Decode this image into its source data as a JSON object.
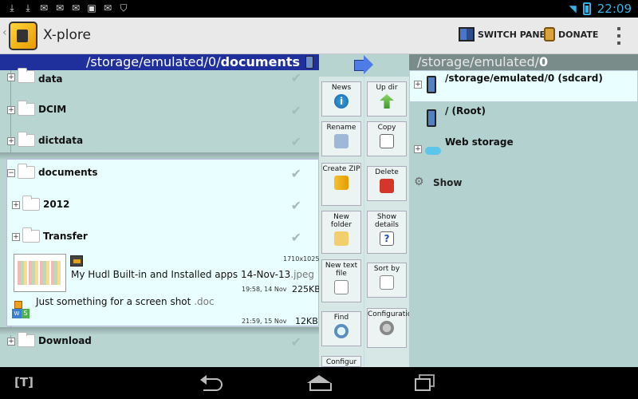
{
  "status": {
    "time": "22:09"
  },
  "actionbar": {
    "app_title": "X-plore",
    "switch_pane": "SWITCH PANE",
    "donate": "DONATE"
  },
  "left": {
    "path_prefix": "/storage/emulated/0/",
    "path_bold": "documents",
    "rows": [
      {
        "label": "data"
      },
      {
        "label": "DCIM"
      },
      {
        "label": "dictdata"
      },
      {
        "label": "documents"
      },
      {
        "label": "2012"
      },
      {
        "label": "Transfer"
      },
      {
        "label": "Download"
      }
    ],
    "files": [
      {
        "name": "My Hudl Built-in and Installed apps 14-Nov-13",
        "ext": ".jpeg",
        "dims": "1710x1025",
        "time": "19:58, 14 Nov",
        "size": "225KB"
      },
      {
        "name": "Just something for a screen shot",
        "ext": ".doc",
        "time": "21:59, 15 Nov",
        "size": "12KB"
      }
    ]
  },
  "middle": {
    "buttons": [
      "News",
      "Up dir",
      "Rename",
      "Copy",
      "Create ZIP",
      "Delete",
      "New folder",
      "Show details",
      "New text file",
      "Sort by",
      "Find",
      "Configuration",
      "Configur"
    ]
  },
  "right": {
    "path_prefix": "/storage/emulated/",
    "path_bold": "0",
    "rows": [
      {
        "label": "/storage/emulated/0 (sdcard)"
      },
      {
        "label": "/ (Root)"
      },
      {
        "label": "Web storage"
      }
    ],
    "show": "Show"
  },
  "navbar": {
    "t_label": "[T]"
  }
}
